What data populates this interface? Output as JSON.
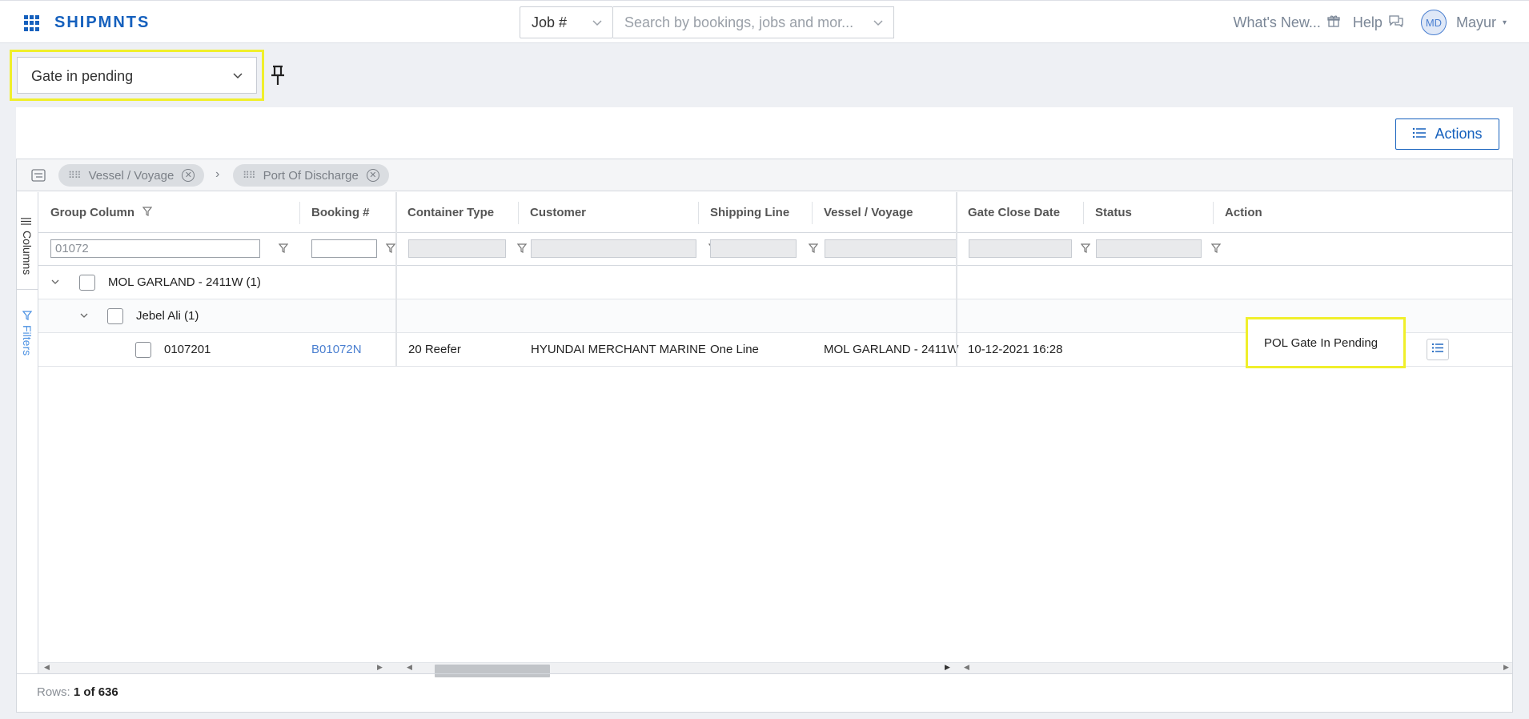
{
  "topbar": {
    "brand": "SHIPMNTS",
    "job_select": "Job #",
    "search_placeholder": "Search by bookings, jobs and mor...",
    "whats_new": "What's New...",
    "help": "Help",
    "avatar_initials": "MD",
    "user_name": "Mayur"
  },
  "view": {
    "selected": "Gate in pending"
  },
  "toolbar": {
    "actions_label": "Actions"
  },
  "group_bar": {
    "chips": [
      "Vessel / Voyage",
      "Port Of Discharge"
    ]
  },
  "side_tabs": {
    "columns": "Columns",
    "filters": "Filters"
  },
  "columns": [
    "Group Column",
    "Booking #",
    "Container Type",
    "Customer",
    "Shipping Line",
    "Vessel / Voyage",
    "Gate Close Date",
    "Status",
    "Action"
  ],
  "filters": {
    "group_column_value": "01072",
    "booking_value": ""
  },
  "rows": {
    "group1": "MOL GARLAND - 2411W (1)",
    "group2": "Jebel Ali (1)",
    "record": {
      "group_column": "0107201",
      "booking": "B01072N",
      "container_type": "20 Reefer",
      "customer": "HYUNDAI MERCHANT MARINE",
      "shipping_line": "One Line",
      "vessel_voyage": "MOL GARLAND - 2411W",
      "gate_close_date": "10-12-2021 16:28",
      "status": "POL Gate In Pending"
    }
  },
  "footer": {
    "rows_label": "Rows:",
    "rows_value": "1 of 636"
  },
  "colors": {
    "brand_blue": "#1560bd",
    "highlight": "#f0ef2b",
    "link": "#4a7fd0"
  }
}
